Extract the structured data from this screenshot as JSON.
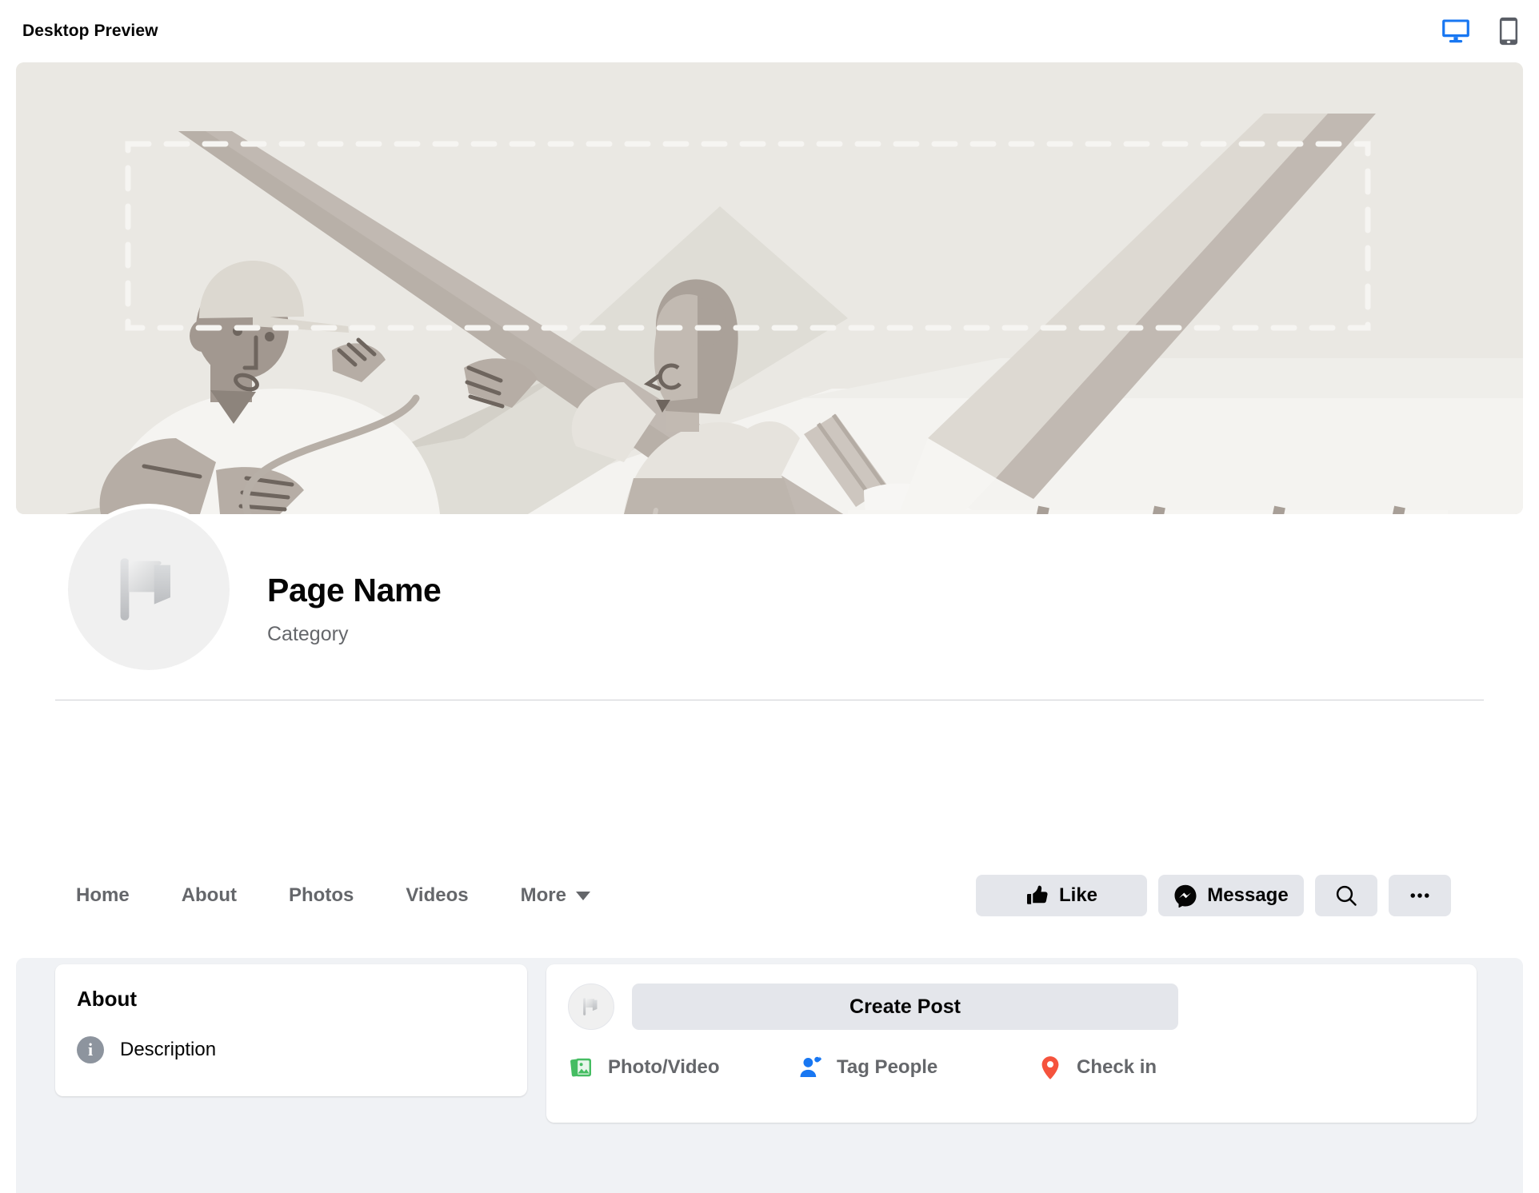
{
  "topbar": {
    "title": "Desktop Preview",
    "desktop_icon": "desktop-monitor-icon",
    "mobile_icon": "mobile-phone-icon",
    "desktop_color": "#1877f2",
    "mobile_color": "#5a5e66"
  },
  "cover": {
    "icon": "cover-photo-illustration",
    "background_color": "#eae8e3",
    "guide_color": "#f4f3f0",
    "description": "Placeholder illustration of two people carrying a large panel with a giant paintbrush and pencil"
  },
  "profile": {
    "avatar_icon": "flag-placeholder-icon",
    "name": "Page Name",
    "category": "Category"
  },
  "nav": {
    "tabs": [
      {
        "label": "Home"
      },
      {
        "label": "About"
      },
      {
        "label": "Photos"
      },
      {
        "label": "Videos"
      },
      {
        "label": "More",
        "caret": true
      }
    ]
  },
  "actions": {
    "like_label": "Like",
    "like_icon": "thumbs-up-icon",
    "message_label": "Message",
    "message_icon": "messenger-icon",
    "search_icon": "search-icon",
    "more_icon": "ellipsis-icon"
  },
  "about_card": {
    "title": "About",
    "info_icon": "info-icon",
    "info_glyph": "i",
    "description": "Description"
  },
  "post_card": {
    "avatar_icon": "flag-placeholder-icon",
    "create_post_label": "Create Post",
    "actions": [
      {
        "label": "Photo/Video",
        "icon": "photo-video-icon",
        "color": "#45bd62"
      },
      {
        "label": "Tag People",
        "icon": "tag-people-icon",
        "color": "#1877f2"
      },
      {
        "label": "Check in",
        "icon": "location-pin-icon",
        "color": "#f5533d"
      }
    ]
  }
}
